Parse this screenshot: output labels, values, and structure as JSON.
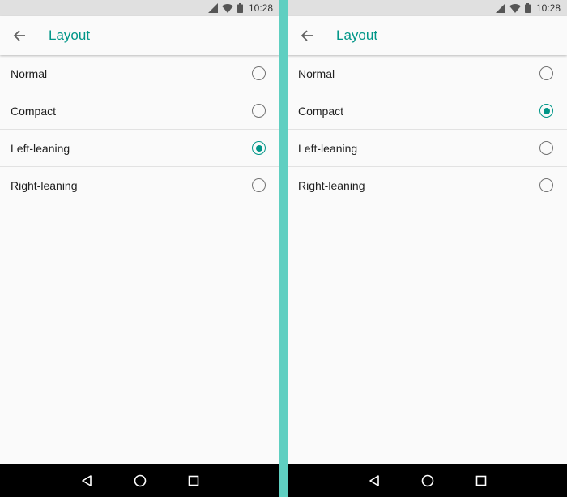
{
  "colors": {
    "accent": "#009688",
    "divider": "#5fcfc1",
    "statusbar": "#e0e0e0",
    "navbar": "#000000"
  },
  "icons": {
    "status": [
      "signal-icon",
      "wifi-icon",
      "battery-icon"
    ],
    "nav": [
      "nav-back-icon",
      "nav-home-icon",
      "nav-recents-icon"
    ],
    "appbar": "back-arrow-icon"
  },
  "screens": [
    {
      "status": {
        "time": "10:28"
      },
      "title": "Layout",
      "options": [
        {
          "label": "Normal",
          "checked": false
        },
        {
          "label": "Compact",
          "checked": false
        },
        {
          "label": "Left-leaning",
          "checked": true
        },
        {
          "label": "Right-leaning",
          "checked": false
        }
      ]
    },
    {
      "status": {
        "time": "10:28"
      },
      "title": "Layout",
      "options": [
        {
          "label": "Normal",
          "checked": false
        },
        {
          "label": "Compact",
          "checked": true
        },
        {
          "label": "Left-leaning",
          "checked": false
        },
        {
          "label": "Right-leaning",
          "checked": false
        }
      ]
    }
  ]
}
